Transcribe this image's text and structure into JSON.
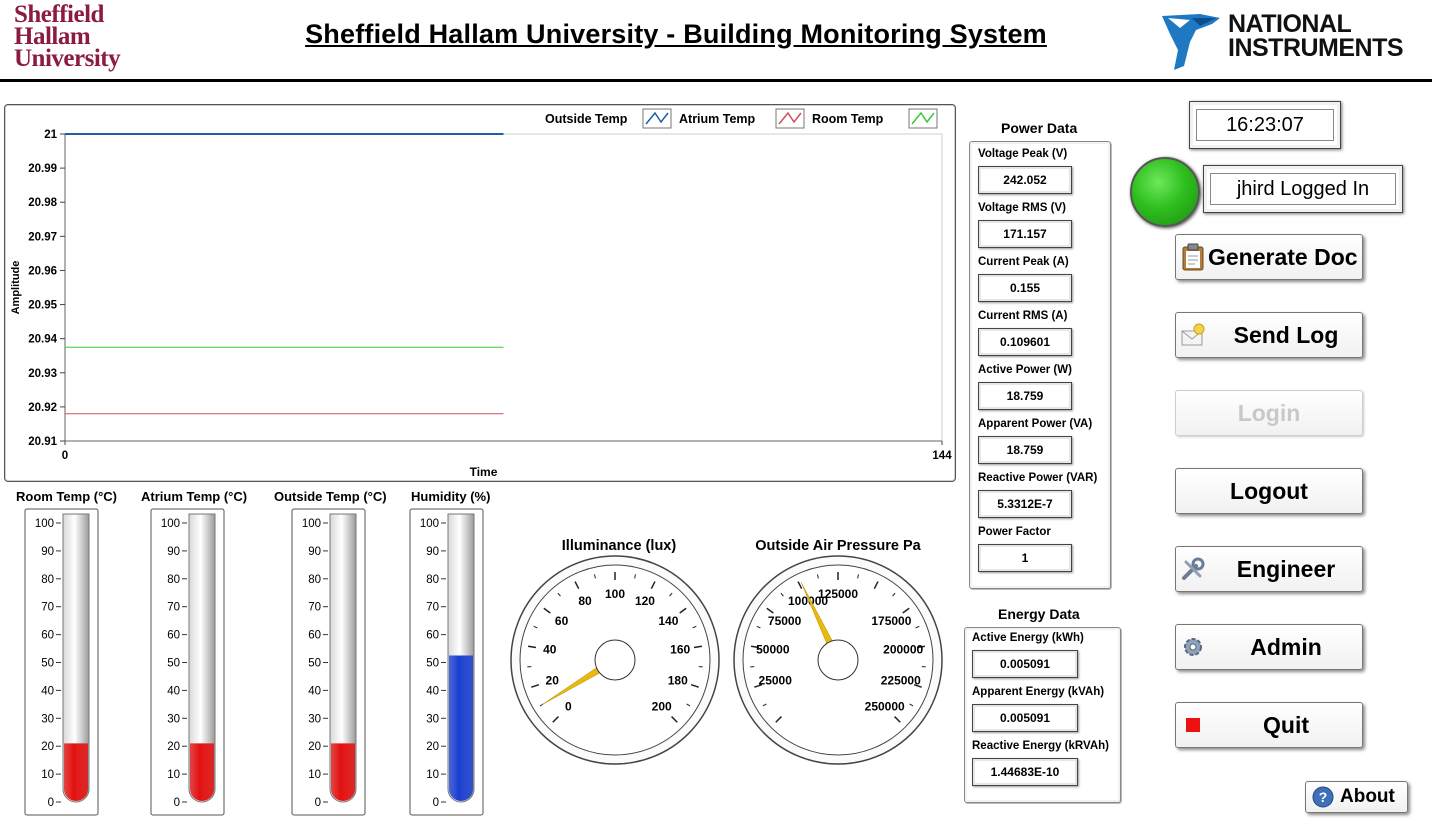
{
  "header": {
    "university_line1": "Sheffield",
    "university_line2": "Hallam",
    "university_line3": "University",
    "title": "Sheffield Hallam University - Building Monitoring System",
    "ni_line1": "NATIONAL",
    "ni_line2": "INSTRUMENTS"
  },
  "chart_data": {
    "type": "line",
    "xlabel": "Time",
    "ylabel": "Amplitude",
    "xlim": [
      0,
      144
    ],
    "ylim": [
      20.91,
      21.0
    ],
    "x_ticks": [
      "0",
      "144"
    ],
    "y_ticks": [
      "21",
      "20.99",
      "20.98",
      "20.97",
      "20.96",
      "20.95",
      "20.94",
      "20.93",
      "20.92",
      "20.91"
    ],
    "legend_placement": "top-right",
    "grid": false,
    "series": [
      {
        "name": "Outside Temp",
        "color": "#1f5fa5",
        "x": [
          0,
          72
        ],
        "y": [
          21.0,
          21.0
        ]
      },
      {
        "name": "Atrium Temp",
        "color": "#d0505a",
        "x": [
          0,
          72
        ],
        "y": [
          20.918,
          20.918
        ]
      },
      {
        "name": "Room Temp",
        "color": "#33cc33",
        "x": [
          0,
          72
        ],
        "y": [
          20.9375,
          20.9375
        ]
      }
    ]
  },
  "tanks": [
    {
      "label": "Room Temp (°C)",
      "value": 21,
      "color": "#e21010"
    },
    {
      "label": "Atrium Temp (°C)",
      "value": 21,
      "color": "#e21010"
    },
    {
      "label": "Outside Temp (°C)",
      "value": 21,
      "color": "#e21010"
    },
    {
      "label": "Humidity (%)",
      "value": 52.5,
      "color": "#1a3fcf"
    }
  ],
  "tank_scale": [
    "100",
    "90",
    "80",
    "70",
    "60",
    "50",
    "40",
    "30",
    "20",
    "10",
    "0"
  ],
  "gauges": [
    {
      "label": "Illuminance (lux)",
      "min": 0,
      "max": 200,
      "value": 10,
      "ticks": [
        "0",
        "20",
        "40",
        "60",
        "80",
        "100",
        "120",
        "140",
        "160",
        "180",
        "200"
      ]
    },
    {
      "label": "Outside Air Pressure Pa",
      "min": 0,
      "max": 250000,
      "value": 101500,
      "ticks": [
        "25000",
        "50000",
        "75000",
        "100000",
        "125000",
        "175000",
        "200000",
        "225000",
        "250000"
      ]
    }
  ],
  "power": {
    "title": "Power Data",
    "items": [
      {
        "label": "Voltage Peak (V)",
        "value": "242.052"
      },
      {
        "label": "Voltage RMS (V)",
        "value": "171.157"
      },
      {
        "label": "Current Peak (A)",
        "value": "0.155"
      },
      {
        "label": "Current RMS (A)",
        "value": "0.109601"
      },
      {
        "label": "Active Power (W)",
        "value": "18.759"
      },
      {
        "label": "Apparent Power (VA)",
        "value": "18.759"
      },
      {
        "label": "Reactive Power (VAR)",
        "value": "5.3312E-7"
      },
      {
        "label": "Power Factor",
        "value": "1"
      }
    ]
  },
  "energy": {
    "title": "Energy Data",
    "items": [
      {
        "label": "Active Energy (kWh)",
        "value": "0.005091"
      },
      {
        "label": "Apparent Energy (kVAh)",
        "value": "0.005091"
      },
      {
        "label": "Reactive Energy (kRVAh)",
        "value": "1.44683E-10"
      }
    ]
  },
  "status": {
    "clock": "16:23:07",
    "user": "jhird Logged In",
    "led_color": "#2fbf1f"
  },
  "buttons": {
    "generate_doc": "Generate Doc",
    "send_log": "Send Log",
    "login": "Login",
    "logout": "Logout",
    "engineer": "Engineer",
    "admin": "Admin",
    "quit": "Quit",
    "about": "About"
  }
}
